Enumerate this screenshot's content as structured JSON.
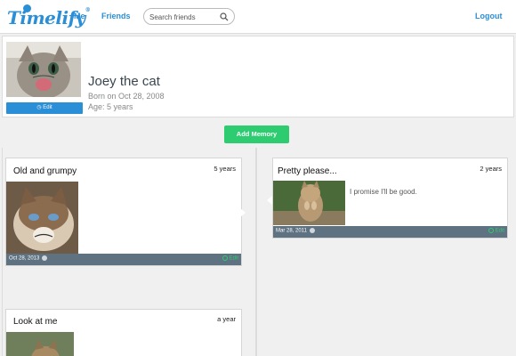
{
  "header": {
    "logo": "Timelify",
    "logo_mark": "®",
    "nav_me": "Me",
    "nav_friends": "Friends",
    "search_placeholder": "Search friends",
    "logout": "Logout"
  },
  "profile": {
    "name": "Joey the cat",
    "born": "Born on Oct 28, 2008",
    "age": "Age: 5 years",
    "edit_label": "Edit"
  },
  "timeline": {
    "add_label": "Add Memory",
    "memories": [
      {
        "title": "Old and grumpy",
        "age": "5 years",
        "date": "Oct 28, 2013",
        "edit": "Edit",
        "text": ""
      },
      {
        "title": "Pretty please...",
        "age": "2 years",
        "date": "Mar 28, 2011",
        "edit": "Edit",
        "text": "I promise I'll be good."
      },
      {
        "title": "Look at me",
        "age": "a year",
        "date": "",
        "edit": "",
        "text": ""
      }
    ]
  },
  "colors": {
    "accent": "#2a8fd6",
    "green": "#2ecc71",
    "footer": "#5e7282"
  }
}
